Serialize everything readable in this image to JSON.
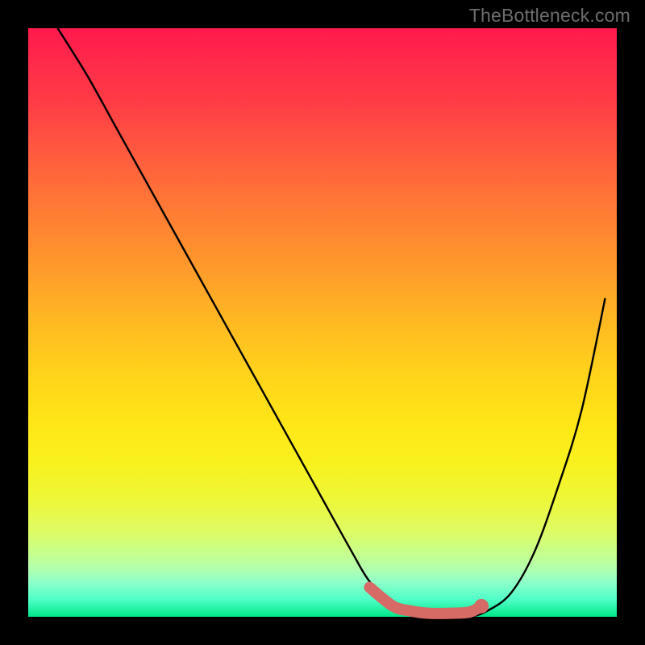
{
  "watermark": "TheBottleneck.com",
  "chart_data": {
    "type": "line",
    "title": "",
    "xlabel": "",
    "ylabel": "",
    "xlim": [
      0,
      100
    ],
    "ylim": [
      0,
      100
    ],
    "grid": false,
    "series": [
      {
        "name": "bottleneck-curve",
        "color": "#000000",
        "x": [
          5,
          10,
          15,
          20,
          25,
          30,
          35,
          40,
          45,
          50,
          55,
          58,
          62,
          65,
          68,
          72,
          75,
          78,
          82,
          86,
          90,
          94,
          98
        ],
        "values": [
          100,
          92,
          83,
          74,
          65,
          56,
          47,
          38,
          29,
          20,
          11,
          6,
          2,
          1,
          0,
          0,
          0,
          1,
          4,
          11,
          22,
          35,
          54
        ]
      },
      {
        "name": "recommended-band",
        "color": "#d66a65",
        "x": [
          58,
          62,
          65,
          68,
          72,
          75,
          77
        ],
        "values": [
          5,
          1.8,
          1,
          0.6,
          0.6,
          0.8,
          1.8
        ]
      }
    ],
    "markers": [
      {
        "name": "band-end-dot",
        "x": 77,
        "y": 1.8,
        "color": "#d66a65"
      }
    ],
    "gradient_stops": [
      {
        "pos": 0,
        "color": "#ff1a4d"
      },
      {
        "pos": 50,
        "color": "#ffc020"
      },
      {
        "pos": 80,
        "color": "#eef738"
      },
      {
        "pos": 100,
        "color": "#00e88a"
      }
    ]
  }
}
